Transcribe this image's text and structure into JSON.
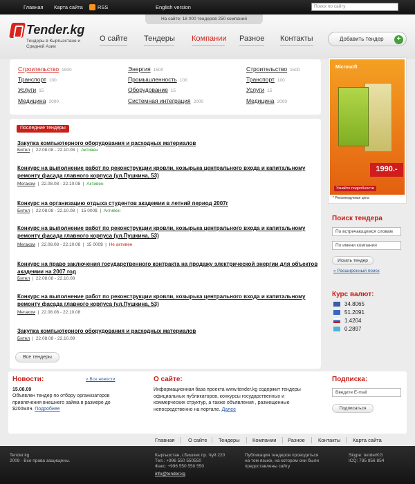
{
  "topbar": {
    "home": "Главная",
    "sitemap": "Карта сайта",
    "rss": "RSS",
    "english": "English version",
    "search_placeholder": "Поиск по сайту"
  },
  "stats": {
    "text": "На сайте:  18 000 тендеров   250 компаний"
  },
  "logo": {
    "name": "Tender.kg",
    "tagline": "Тендеры в Кыргызстане и Средней Азии"
  },
  "nav": {
    "items": [
      "О сайте",
      "Тендеры",
      "Компании",
      "Разное",
      "Контакты"
    ],
    "active": "Компании",
    "add_button": "Добавить тендер"
  },
  "categories": {
    "columns": [
      [
        {
          "label": "Строительство",
          "count": "1500"
        },
        {
          "label": "Транспорт",
          "count": "100"
        },
        {
          "label": "Услуги",
          "count": "15"
        },
        {
          "label": "Медицина",
          "count": "2000"
        }
      ],
      [
        {
          "label": "Энергия",
          "count": "1500"
        },
        {
          "label": "Промышленность",
          "count": "100"
        },
        {
          "label": "Оборудование",
          "count": "15"
        },
        {
          "label": "Системная интеграция",
          "count": "2000"
        }
      ],
      [
        {
          "label": "Строительство",
          "count": "1500"
        },
        {
          "label": "Транспорт",
          "count": "100"
        },
        {
          "label": "Услуги",
          "count": "15"
        },
        {
          "label": "Медицина",
          "count": "2000"
        }
      ]
    ]
  },
  "tenders": {
    "badge": "Последние тендеры",
    "all_button": "Все тендеры",
    "items": [
      {
        "title": "Закупка компьютерного оборудования и расходных материалов",
        "company": "Бител",
        "dates": "22.08.08 - 22.10.08",
        "amount": "",
        "status": "Активен",
        "status_color": "green"
      },
      {
        "title": "Конкурс на выполнение работ по реконструкции кровли, козырька центрального входа и капитальному ремонту фасада главного корпуса (ул.Пушкина, 53)",
        "company": "Мегаком",
        "dates": "22.08.08 - 22.10.08",
        "amount": "",
        "status": "Активен",
        "status_color": "green"
      },
      {
        "title": "Конкурс на организацию отдыха студентов академии в летний период 2007г",
        "company": "Бител",
        "dates": "22.08.08 - 22.10.08",
        "amount": "15 000$",
        "status": "Активен",
        "status_color": "green"
      },
      {
        "title": "Конкурс на выполнение работ по реконструкции кровли, козырька центрального входа и капитальному ремонту фасада главного корпуса (ул.Пушкина, 53)",
        "company": "Мегаком",
        "dates": "22.08.08 - 22.10.08",
        "amount": "15 000$",
        "status": "Не активен",
        "status_color": "red"
      },
      {
        "title": "Конкурс на право заключения государственного контракта на продажу электрической энергии для объектов академии на 2007 год",
        "company": "Бител",
        "dates": "22.08.08 - 22.10.08",
        "amount": "",
        "status": "",
        "status_color": ""
      },
      {
        "title": "Конкурс на выполнение работ по реконструкции кровли, козырька центрального входа и капитальному ремонту фасада главного корпуса (ул.Пушкина, 53)",
        "company": "Мегаком",
        "dates": "22.08.08 - 22.10.08",
        "amount": "",
        "status": "",
        "status_color": ""
      },
      {
        "title": "Закупка компьютерного оборудования и расходных материалов",
        "company": "Бител",
        "dates": "22.08.08 - 22.10.08",
        "amount": "",
        "status": "",
        "status_color": ""
      }
    ]
  },
  "ad": {
    "brand": "Microsoft",
    "price": "1990.-",
    "more": "Узнайте подробности",
    "note": "* Рекомендуемая цена"
  },
  "search": {
    "title": "Поиск тендера",
    "keywords_placeholder": "По встречающимся словам",
    "company_placeholder": "По имени компании",
    "button": "Искать тендер",
    "advanced": "Расширенный поиск"
  },
  "rates": {
    "title": "Курс валют",
    "items": [
      {
        "value": "34.8065",
        "color": "#3b5ba5"
      },
      {
        "value": "51.2091",
        "color": "#3a66c4"
      },
      {
        "value": "1.4204",
        "color": "#c8201a"
      },
      {
        "value": "0.2897",
        "color": "#4fb3d9"
      }
    ]
  },
  "news": {
    "title": "Новости",
    "all_link": "Все новости",
    "date": "15.08.09",
    "text": "Объявлен тендер по отбору организаторов привлечения внешнего займа в размере до $200млн.",
    "more": "Подробнее"
  },
  "about": {
    "title": "О сайте",
    "text": "Информационная база проекта www.tender.kg содержит тендеры официальных публикаторов, конкурсы государственных и коммерческих структур, а также объявления , размещенные непосредственно на портале.",
    "more": "Далее"
  },
  "subscribe": {
    "title": "Подписка",
    "placeholder": "Введите E-mail",
    "button": "Подписаться"
  },
  "footer_nav": [
    "Главная",
    "О сайте",
    "Тендеры",
    "Компании",
    "Разное",
    "Контакты",
    "Карта сайта"
  ],
  "footer": {
    "brand": "Tender.kg",
    "rights": "2008 · Все права защищены.",
    "address": "Кыргызстан, г.Бишкек  пр. Чуй 220",
    "phone": "Тел.: +996 550 550550",
    "fax": "Факс: +996 550 550 550",
    "email": "info@tender.kg",
    "note": "Публикация тендеров проводиться на том языке, на котором они были предоставлены сайту",
    "skype": "Skype: tenderKG",
    "icq": "ICQ: 785 856 854"
  }
}
